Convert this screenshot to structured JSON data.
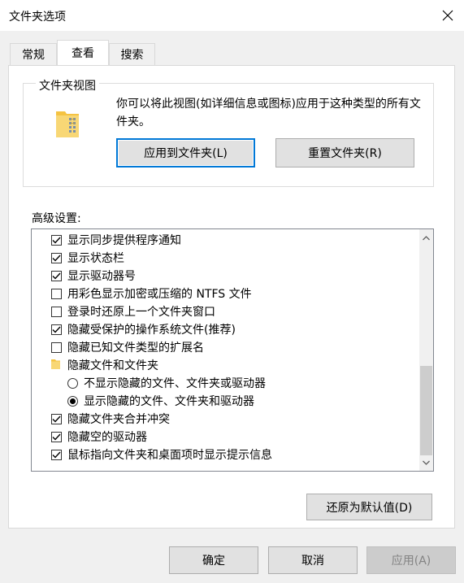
{
  "window": {
    "title": "文件夹选项",
    "close_icon": "close-icon"
  },
  "tabs": [
    {
      "label": "常规"
    },
    {
      "label": "查看"
    },
    {
      "label": "搜索"
    }
  ],
  "folder_views": {
    "group_title": "文件夹视图",
    "description": "你可以将此视图(如详细信息或图标)应用于这种类型的所有文件夹。",
    "apply_button": "应用到文件夹(L)",
    "reset_button": "重置文件夹(R)"
  },
  "advanced": {
    "label": "高级设置:",
    "items": [
      {
        "type": "checkbox",
        "checked": true,
        "label": "显示同步提供程序通知"
      },
      {
        "type": "checkbox",
        "checked": true,
        "label": "显示状态栏"
      },
      {
        "type": "checkbox",
        "checked": true,
        "label": "显示驱动器号"
      },
      {
        "type": "checkbox",
        "checked": false,
        "label": "用彩色显示加密或压缩的 NTFS 文件"
      },
      {
        "type": "checkbox",
        "checked": false,
        "label": "登录时还原上一个文件夹窗口"
      },
      {
        "type": "checkbox",
        "checked": true,
        "label": "隐藏受保护的操作系统文件(推荐)"
      },
      {
        "type": "checkbox",
        "checked": false,
        "label": "隐藏已知文件类型的扩展名"
      },
      {
        "type": "folder",
        "label": "隐藏文件和文件夹"
      },
      {
        "type": "radio",
        "checked": false,
        "label": "不显示隐藏的文件、文件夹或驱动器"
      },
      {
        "type": "radio",
        "checked": true,
        "label": "显示隐藏的文件、文件夹和驱动器"
      },
      {
        "type": "checkbox",
        "checked": true,
        "label": "隐藏文件夹合并冲突"
      },
      {
        "type": "checkbox",
        "checked": true,
        "label": "隐藏空的驱动器"
      },
      {
        "type": "checkbox",
        "checked": true,
        "label": "鼠标指向文件夹和桌面项时显示提示信息"
      }
    ]
  },
  "restore_defaults_button": "还原为默认值(D)",
  "footer": {
    "ok": "确定",
    "cancel": "取消",
    "apply": "应用(A)"
  },
  "colors": {
    "accent": "#0078d7",
    "folder": "#f5c342"
  }
}
